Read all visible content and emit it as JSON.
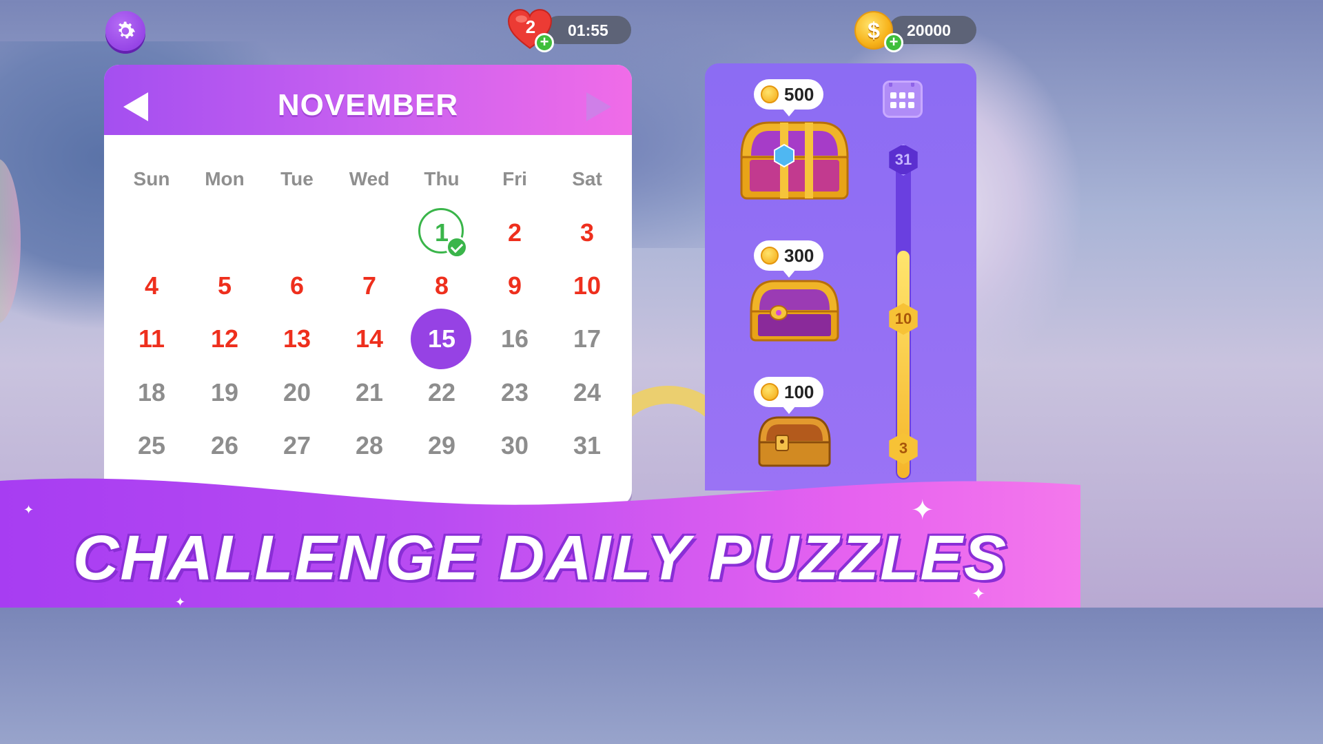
{
  "top_bar": {
    "lives": "2",
    "timer": "01:55",
    "coins": "20000"
  },
  "calendar": {
    "month": "NOVEMBER",
    "weekdays": [
      "Sun",
      "Mon",
      "Tue",
      "Wed",
      "Thu",
      "Fri",
      "Sat"
    ],
    "completed_day": "1",
    "today": "15",
    "weeks": [
      [
        "",
        "",
        "",
        "",
        "1",
        "2",
        "3"
      ],
      [
        "4",
        "5",
        "6",
        "7",
        "8",
        "9",
        "10"
      ],
      [
        "11",
        "12",
        "13",
        "14",
        "15",
        "16",
        "17"
      ],
      [
        "18",
        "19",
        "20",
        "21",
        "22",
        "23",
        "24"
      ],
      [
        "25",
        "26",
        "27",
        "28",
        "29",
        "30",
        "31"
      ]
    ]
  },
  "rewards": {
    "chests": [
      {
        "coins": "500",
        "milestone": "31"
      },
      {
        "coins": "300",
        "milestone": "10"
      },
      {
        "coins": "100",
        "milestone": "3"
      }
    ]
  },
  "banner": {
    "headline": "CHALLENGE DAILY PUZZLES"
  },
  "colors": {
    "accent_purple": "#9642e4",
    "past_day_red": "#ee2f1d",
    "future_day_grey": "#8d8d8d",
    "completed_green": "#3ab54a"
  }
}
